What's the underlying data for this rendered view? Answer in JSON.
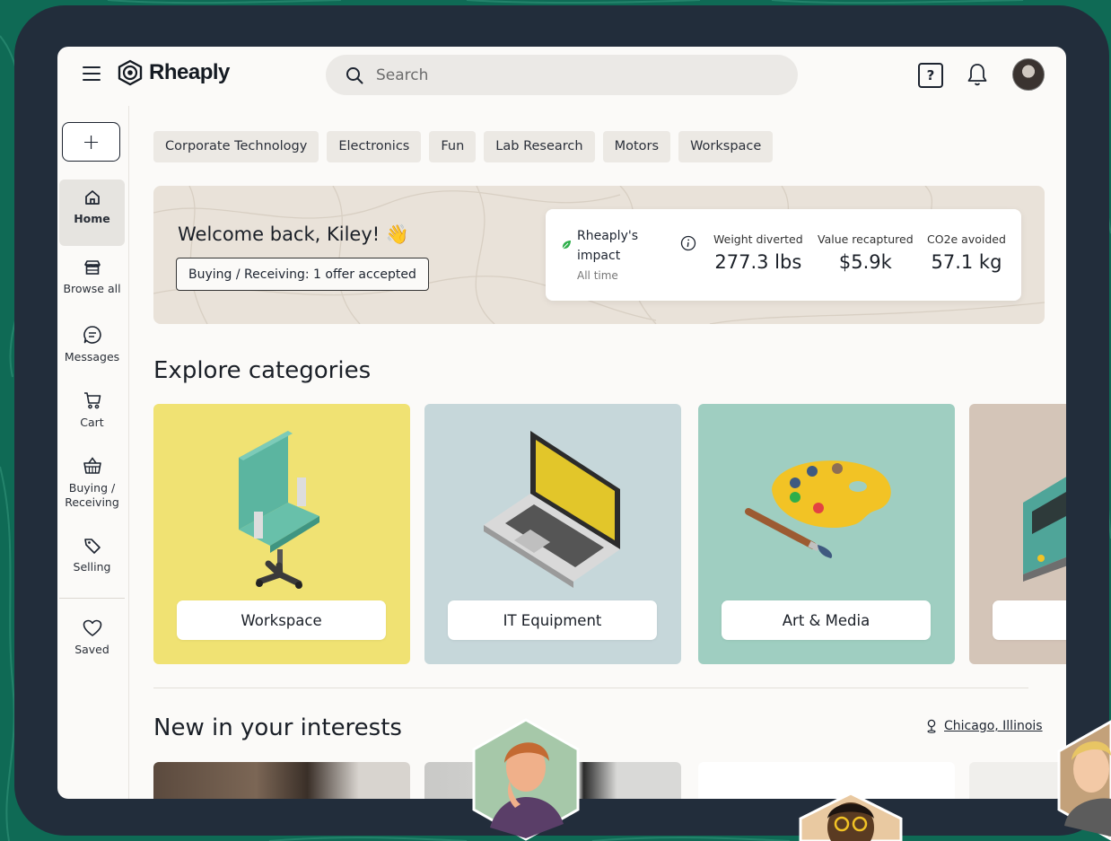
{
  "app": {
    "name": "Rheaply"
  },
  "search": {
    "placeholder": "Search"
  },
  "categories_chips": [
    "Corporate Technology",
    "Electronics",
    "Fun",
    "Lab Research",
    "Motors",
    "Workspace"
  ],
  "sidebar": {
    "items": [
      {
        "label": "Home",
        "icon": "home-icon"
      },
      {
        "label": "Browse all",
        "icon": "storefront-icon"
      },
      {
        "label": "Messages",
        "icon": "message-icon"
      },
      {
        "label": "Cart",
        "icon": "cart-icon"
      },
      {
        "label": "Buying / Receiving",
        "icon": "basket-icon"
      },
      {
        "label": "Selling",
        "icon": "tag-icon"
      },
      {
        "label": "Saved",
        "icon": "heart-icon"
      }
    ]
  },
  "banner": {
    "welcome": "Welcome back, Kiley! 👋",
    "offer_status": "Buying / Receiving: 1 offer accepted",
    "impact": {
      "title": "Rheaply's impact",
      "period": "All time",
      "stats": [
        {
          "label": "Weight diverted",
          "value": "277.3 lbs"
        },
        {
          "label": "Value recaptured",
          "value": "$5.9k"
        },
        {
          "label": "CO2e avoided",
          "value": "57.1 kg"
        }
      ]
    }
  },
  "explore": {
    "title": "Explore categories",
    "cards": [
      {
        "label": "Workspace",
        "color": "#f0e273"
      },
      {
        "label": "IT Equipment",
        "color": "#c6d7da"
      },
      {
        "label": "Art & Media",
        "color": "#9fcec1"
      },
      {
        "label": "",
        "color": "#d4c5b8"
      }
    ]
  },
  "interests": {
    "title": "New in your interests",
    "location": "Chicago, Illinois"
  },
  "colors": {
    "background": "#0f6a55",
    "frame": "#222d3b",
    "screen": "#fbfaf8",
    "accent_leaf": "#2eae4a"
  }
}
